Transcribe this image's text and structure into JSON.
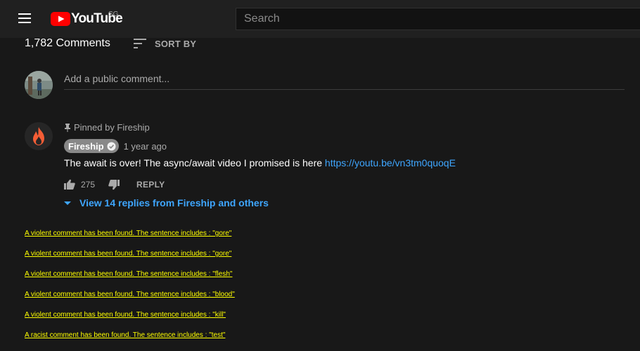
{
  "header": {
    "logo_text": "YouTube",
    "region": "SG",
    "search_placeholder": "Search"
  },
  "comments": {
    "count_label": "1,782 Comments",
    "sort_label": "SORT BY",
    "add_comment_placeholder": "Add a public comment..."
  },
  "pinned_comment": {
    "pinned_label": "Pinned by Fireship",
    "author": "Fireship",
    "timestamp": "1 year ago",
    "text": "The await is over! The async/await video I promised is here ",
    "link": "https://youtu.be/vn3tm0quoqE",
    "likes": "275",
    "reply_label": "REPLY",
    "view_replies_label": "View 14 replies from Fireship and others"
  },
  "alerts": [
    "A violent comment has been found. The sentence includes : \"gore\"",
    "A violent comment has been found. The sentence includes : \"gore\"",
    "A violent comment has been found. The sentence includes : \"flesh\"",
    "A violent comment has been found. The sentence includes : \"blood\"",
    "A violent comment has been found. The sentence includes : \"kill\"",
    "A racist comment has been found. The sentence includes : \"test\""
  ],
  "colors": {
    "background": "#181818",
    "masthead": "#202020",
    "brand_red": "#ff0000",
    "link_blue": "#3ea6ff",
    "alert_yellow": "#ffff00",
    "fireship_orange": "#f55d35"
  },
  "icons": {
    "menu": "hamburger-menu-icon",
    "logo": "youtube-play-icon",
    "sort": "sort-lines-icon",
    "pin": "pin-icon",
    "verified": "verified-check-icon",
    "like": "thumbs-up-icon",
    "dislike": "thumbs-down-icon",
    "expand": "chevron-down-icon",
    "channel": "fire-icon"
  }
}
